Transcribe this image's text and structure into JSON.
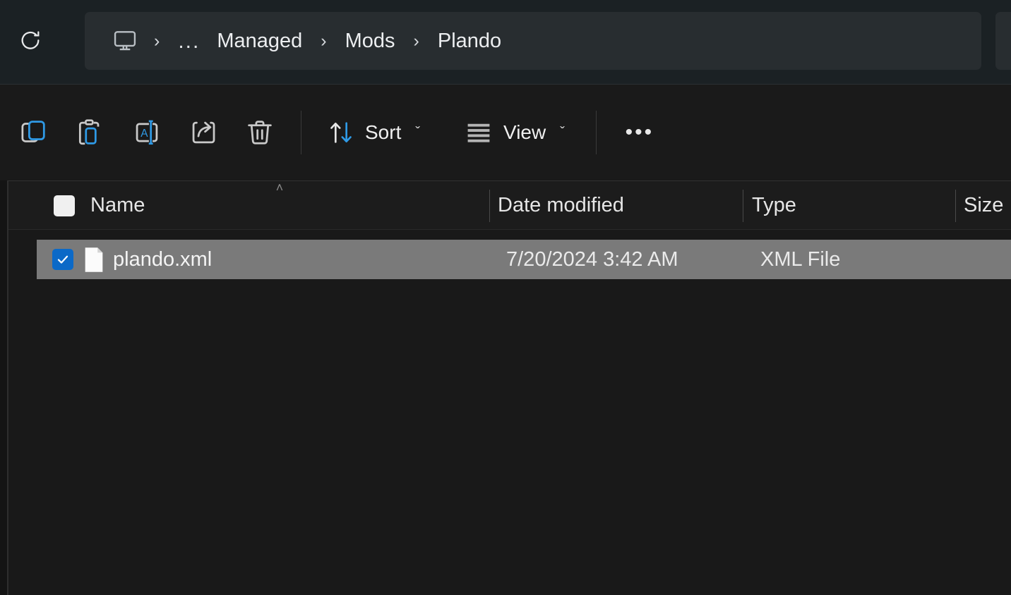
{
  "window": {
    "app": "File Explorer",
    "theme_accent": "#0b69c7",
    "header_bg": "#1b2124",
    "addressbar_bg": "#282d30",
    "content_bg": "#191919",
    "selection_bg": "#7a7a7a"
  },
  "addressbar": {
    "refresh_icon": "refresh-icon",
    "root_icon": "this-pc-monitor-icon",
    "overflow_label": "...",
    "separator": "›",
    "crumbs": [
      {
        "label": "Managed"
      },
      {
        "label": "Mods"
      },
      {
        "label": "Plando"
      }
    ]
  },
  "toolbar": {
    "buttons": [
      {
        "name": "copy-icon",
        "tooltip": "Copy"
      },
      {
        "name": "paste-icon",
        "tooltip": "Paste"
      },
      {
        "name": "rename-icon",
        "tooltip": "Rename"
      },
      {
        "name": "share-icon",
        "tooltip": "Share"
      },
      {
        "name": "delete-icon",
        "tooltip": "Delete"
      }
    ],
    "sort_label": "Sort",
    "view_label": "View",
    "chevron": "ˇ",
    "more_label": "•••"
  },
  "columns": {
    "sort_indicator": "˄",
    "headers": [
      {
        "label": "Name"
      },
      {
        "label": "Date modified"
      },
      {
        "label": "Type"
      },
      {
        "label": "Size"
      }
    ]
  },
  "files": [
    {
      "name": "plando.xml",
      "date_modified": "7/20/2024 3:42 AM",
      "type": "XML File",
      "size": "",
      "selected": true,
      "checked": true,
      "icon": "xml-file-icon"
    }
  ]
}
